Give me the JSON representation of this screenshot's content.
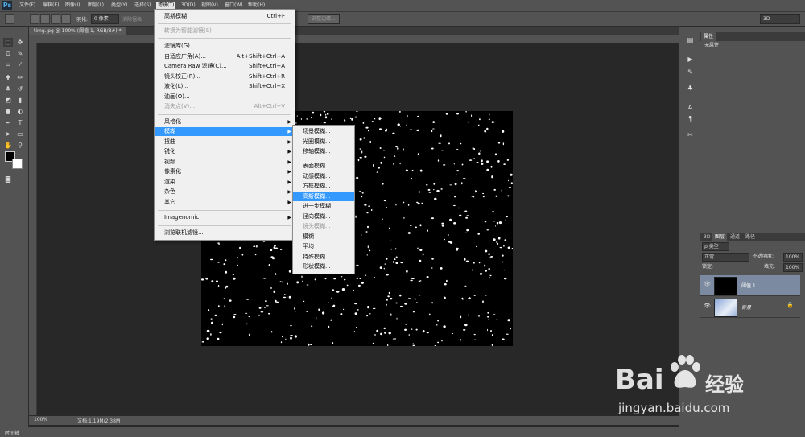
{
  "app": {
    "logo": "Ps"
  },
  "menubar": {
    "items": [
      "文件(F)",
      "编辑(E)",
      "图像(I)",
      "图层(L)",
      "类型(Y)",
      "选择(S)",
      "滤镜(T)",
      "3D(D)",
      "视图(V)",
      "窗口(W)",
      "帮助(H)"
    ],
    "active": "滤镜(T)"
  },
  "optionsbar": {
    "feather_label": "羽化:",
    "feather_value": "0 像素",
    "antialias_label": "消除锯齿",
    "refine_edge_button": "调整边缘...",
    "workspace": "3D"
  },
  "document": {
    "tab_title": "timg.jpg @ 100% (阈值 1, RGB/8#) *",
    "zoom": "100%",
    "doc_info": "文档:1.19M/2.38M"
  },
  "filter_menu": {
    "items": [
      {
        "label": "高斯模糊",
        "shortcut": "Ctrl+F"
      },
      {
        "label": "转换为智能滤镜(S)",
        "disabled": true
      },
      {
        "label": "滤镜库(G)..."
      },
      {
        "label": "自适应广角(A)...",
        "shortcut": "Alt+Shift+Ctrl+A"
      },
      {
        "label": "Camera Raw 滤镜(C)...",
        "shortcut": "Shift+Ctrl+A"
      },
      {
        "label": "镜头校正(R)...",
        "shortcut": "Shift+Ctrl+R"
      },
      {
        "label": "液化(L)...",
        "shortcut": "Shift+Ctrl+X"
      },
      {
        "label": "油画(O)..."
      },
      {
        "label": "消失点(V)...",
        "shortcut": "Alt+Ctrl+V",
        "disabled": true
      },
      {
        "label": "风格化",
        "submenu": true
      },
      {
        "label": "模糊",
        "submenu": true,
        "highlighted": true
      },
      {
        "label": "扭曲",
        "submenu": true
      },
      {
        "label": "锐化",
        "submenu": true
      },
      {
        "label": "视频",
        "submenu": true
      },
      {
        "label": "像素化",
        "submenu": true
      },
      {
        "label": "渲染",
        "submenu": true
      },
      {
        "label": "杂色",
        "submenu": true
      },
      {
        "label": "其它",
        "submenu": true
      },
      {
        "label": "Imagenomic",
        "submenu": true
      },
      {
        "label": "浏览联机滤镜..."
      }
    ]
  },
  "blur_submenu": {
    "items": [
      {
        "label": "场景模糊..."
      },
      {
        "label": "光圈模糊..."
      },
      {
        "label": "移轴模糊..."
      },
      {
        "label": "表面模糊..."
      },
      {
        "label": "动感模糊..."
      },
      {
        "label": "方框模糊..."
      },
      {
        "label": "高斯模糊...",
        "highlighted": true
      },
      {
        "label": "进一步模糊"
      },
      {
        "label": "径向模糊..."
      },
      {
        "label": "镜头模糊...",
        "disabled": true
      },
      {
        "label": "模糊"
      },
      {
        "label": "平均"
      },
      {
        "label": "特殊模糊..."
      },
      {
        "label": "形状模糊..."
      }
    ]
  },
  "properties_panel": {
    "tab": "属性",
    "content": "无属性"
  },
  "layers_panel": {
    "tabs": [
      "3D",
      "图层",
      "通道",
      "路径"
    ],
    "filter_label": "ρ 类型",
    "blend_mode": "正常",
    "opacity_label": "不透明度:",
    "opacity_value": "100%",
    "lock_label": "锁定:",
    "fill_label": "填充:",
    "fill_value": "100%",
    "layers": [
      {
        "name": "阈值 1",
        "selected": true
      },
      {
        "name": "背景",
        "locked": true
      }
    ]
  },
  "timeline": {
    "label": "时间轴"
  },
  "watermark": {
    "brand": "Bai",
    "brand_cn": "经验",
    "url": "jingyan.baidu.com"
  }
}
